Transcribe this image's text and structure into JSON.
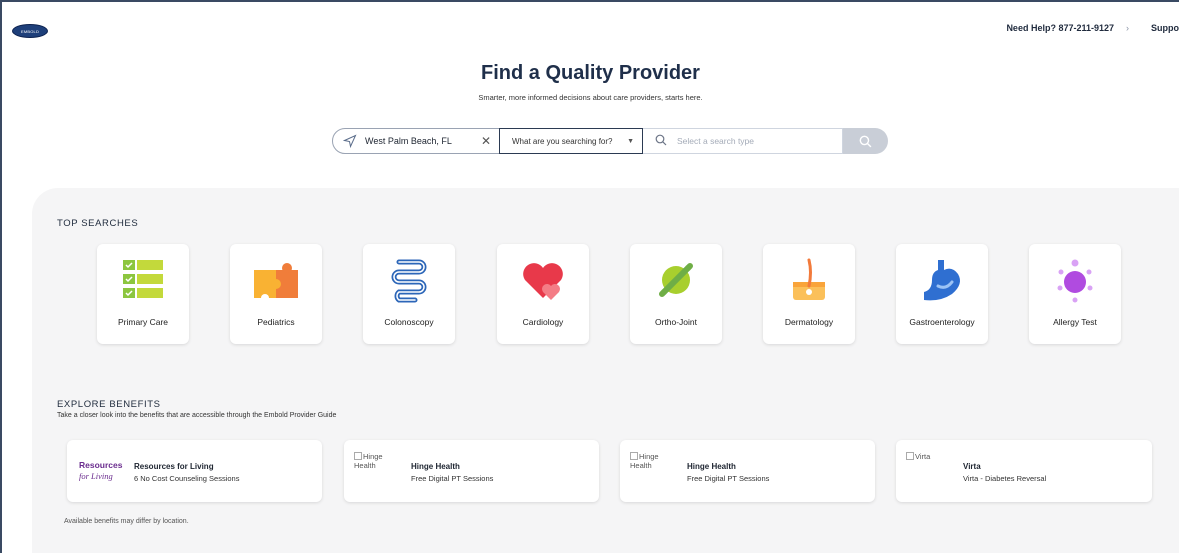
{
  "header": {
    "logo_text": "EMBOLD",
    "help_text": "Need Help? 877-211-9127",
    "help_arrow": "›",
    "support_label": "Suppo"
  },
  "hero": {
    "title": "Find a Quality Provider",
    "subtitle": "Smarter, more informed decisions about care providers, starts here."
  },
  "search": {
    "location_value": "West Palm Beach, FL",
    "search_type_label": "What are you searching for?",
    "query_placeholder": "Select a search type"
  },
  "top_searches": {
    "heading": "TOP SEARCHES",
    "items": [
      {
        "label": "Primary Care",
        "icon": "checklist-icon"
      },
      {
        "label": "Pediatrics",
        "icon": "puzzle-icon"
      },
      {
        "label": "Colonoscopy",
        "icon": "colon-icon"
      },
      {
        "label": "Cardiology",
        "icon": "heart-icon"
      },
      {
        "label": "Ortho-Joint",
        "icon": "bone-icon"
      },
      {
        "label": "Dermatology",
        "icon": "skin-icon"
      },
      {
        "label": "Gastroenterology",
        "icon": "stomach-icon"
      },
      {
        "label": "Allergy Test",
        "icon": "allergen-icon"
      }
    ]
  },
  "benefits": {
    "heading": "EXPLORE BENEFITS",
    "subheading": "Take a closer look into the benefits that are accessible through the Embold Provider Guide",
    "cards": [
      {
        "logo_line1": "Resources",
        "logo_line2": "for Living",
        "title": "Resources for Living",
        "desc": "6 No Cost Counseling Sessions"
      },
      {
        "img_alt_line1": "Hinge",
        "img_alt_line2": "Health",
        "title": "Hinge Health",
        "desc": "Free Digital PT Sessions"
      },
      {
        "img_alt_line1": "Hinge",
        "img_alt_line2": "Health",
        "title": "Hinge Health",
        "desc": "Free Digital PT Sessions"
      },
      {
        "img_alt_line1": "Virta",
        "img_alt_line2": "",
        "title": "Virta",
        "desc": "Virta - Diabetes Reversal"
      }
    ],
    "footnote": "Available benefits may differ by location."
  },
  "colors": {
    "brand_navy": "#1f2f4a",
    "panel_bg": "#f5f5f6",
    "search_button": "#c9ced7"
  }
}
